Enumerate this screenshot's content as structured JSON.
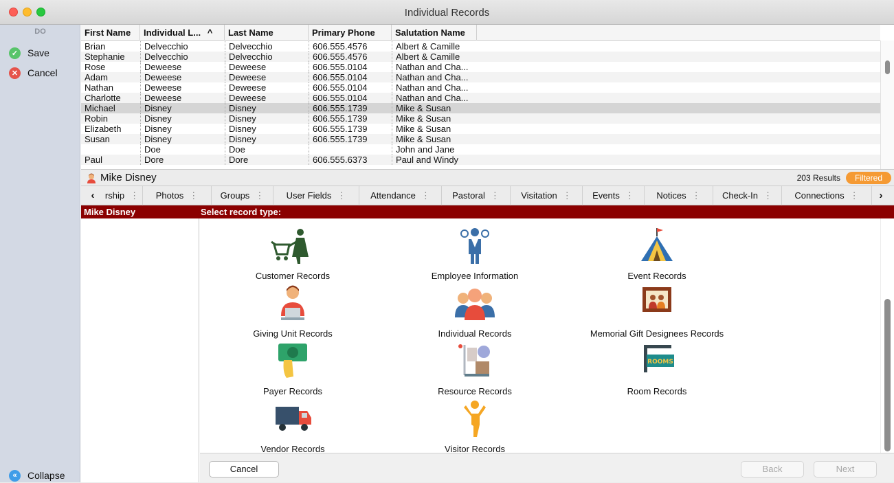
{
  "window": {
    "title": "Individual Records"
  },
  "sidebar": {
    "header": "DO",
    "save_label": "Save",
    "cancel_label": "Cancel",
    "collapse_label": "Collapse"
  },
  "grid": {
    "columns": [
      "First Name",
      "Individual L...",
      "Last Name",
      "Primary Phone",
      "Salutation Name"
    ],
    "sort_indicator": "^",
    "rows": [
      [
        "Brian",
        "Delvecchio",
        "Delvecchio",
        "606.555.4576",
        "Albert & Camille"
      ],
      [
        "Stephanie",
        "Delvecchio",
        "Delvecchio",
        "606.555.4576",
        "Albert & Camille"
      ],
      [
        "Rose",
        "Deweese",
        "Deweese",
        "606.555.0104",
        "Nathan and Cha..."
      ],
      [
        "Adam",
        "Deweese",
        "Deweese",
        "606.555.0104",
        "Nathan and Cha..."
      ],
      [
        "Nathan",
        "Deweese",
        "Deweese",
        "606.555.0104",
        "Nathan and Cha..."
      ],
      [
        "Charlotte",
        "Deweese",
        "Deweese",
        "606.555.0104",
        "Nathan and Cha..."
      ],
      [
        "Michael",
        "Disney",
        "Disney",
        "606.555.1739",
        "Mike & Susan"
      ],
      [
        "Robin",
        "Disney",
        "Disney",
        "606.555.1739",
        "Mike & Susan"
      ],
      [
        "Elizabeth",
        "Disney",
        "Disney",
        "606.555.1739",
        "Mike & Susan"
      ],
      [
        "Susan",
        "Disney",
        "Disney",
        "606.555.1739",
        "Mike & Susan"
      ],
      [
        "",
        "Doe",
        "Doe",
        "",
        "John and Jane"
      ],
      [
        "Paul",
        "Dore",
        "Dore",
        "606.555.6373",
        "Paul and Windy"
      ]
    ],
    "selected_row": 6
  },
  "record_bar": {
    "person_name": "Mike Disney",
    "results": "203 Results",
    "filter_badge": "Filtered"
  },
  "tabs": {
    "prev_arrow": "‹",
    "next_arrow": "›",
    "items": [
      "rship",
      "Photos",
      "Groups",
      "User Fields",
      "Attendance",
      "Pastoral",
      "Visitation",
      "Events",
      "Notices",
      "Check-In",
      "Connections"
    ]
  },
  "redbar": {
    "name": "Mike Disney",
    "prompt": "Select record type:"
  },
  "record_types": [
    {
      "label": "Customer Records",
      "icon": "shopping-cart-person-icon"
    },
    {
      "label": "Employee Information",
      "icon": "employee-icon"
    },
    {
      "label": "Event Records",
      "icon": "tent-icon"
    },
    {
      "label": "Giving Unit Records",
      "icon": "person-laptop-icon"
    },
    {
      "label": "Individual Records",
      "icon": "group-people-icon"
    },
    {
      "label": "Memorial Gift Designees Records",
      "icon": "framed-photo-icon"
    },
    {
      "label": "Payer Records",
      "icon": "hand-money-icon"
    },
    {
      "label": "Resource Records",
      "icon": "resource-cart-icon"
    },
    {
      "label": "Room Records",
      "icon": "room-sign-icon"
    },
    {
      "label": "Vendor Records",
      "icon": "delivery-truck-icon"
    },
    {
      "label": "Visitor Records",
      "icon": "visitor-person-icon"
    }
  ],
  "footer": {
    "cancel_label": "Cancel",
    "back_label": "Back",
    "next_label": "Next"
  }
}
